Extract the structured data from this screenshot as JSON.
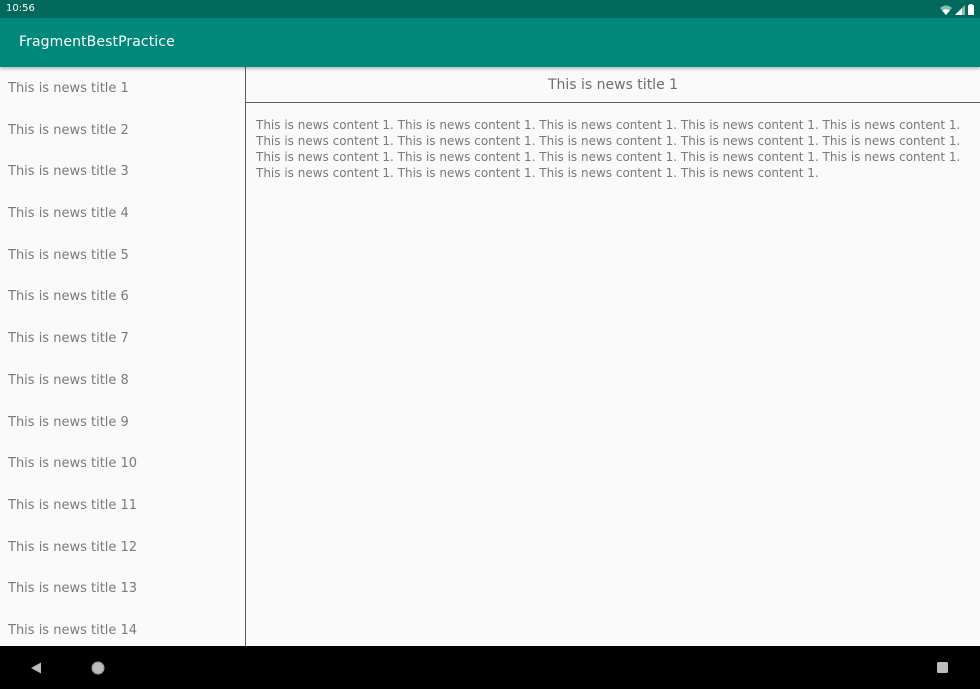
{
  "status_bar": {
    "time": "10:56",
    "icons": [
      "wifi-icon",
      "signal-icon",
      "battery-icon"
    ]
  },
  "app_bar": {
    "title": "FragmentBestPractice",
    "color": "#00897b"
  },
  "news_list": [
    "This is news title 1",
    "This is news title 2",
    "This is news title 3",
    "This is news title 4",
    "This is news title 5",
    "This is news title 6",
    "This is news title 7",
    "This is news title 8",
    "This is news title 9",
    "This is news title 10",
    "This is news title 11",
    "This is news title 12",
    "This is news title 13",
    "This is news title 14"
  ],
  "detail": {
    "title": "This is news title 1",
    "content": "This is news content 1. This is news content 1. This is news content 1. This is news content 1. This is news content 1. This is news content 1. This is news content 1. This is news content 1. This is news content 1. This is news content 1. This is news content 1. This is news content 1. This is news content 1. This is news content 1. This is news content 1. This is news content 1. This is news content 1. This is news content 1. This is news content 1."
  },
  "nav_bar": {
    "buttons": [
      "back-icon",
      "home-icon",
      "recents-icon"
    ]
  }
}
